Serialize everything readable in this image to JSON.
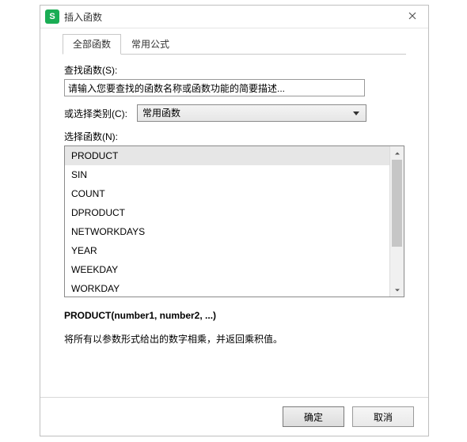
{
  "window": {
    "title": "插入函数",
    "close_label": "Close"
  },
  "tabs": [
    {
      "id": "all",
      "label": "全部函数",
      "active": true
    },
    {
      "id": "formula",
      "label": "常用公式",
      "active": false
    }
  ],
  "search": {
    "label": "查找函数(S):",
    "value": "请输入您要查找的函数名称或函数功能的简要描述..."
  },
  "category": {
    "label": "或选择类别(C):",
    "selected": "常用函数"
  },
  "list": {
    "label": "选择函数(N):",
    "items": [
      {
        "name": "PRODUCT",
        "selected": true
      },
      {
        "name": "SIN",
        "selected": false
      },
      {
        "name": "COUNT",
        "selected": false
      },
      {
        "name": "DPRODUCT",
        "selected": false
      },
      {
        "name": "NETWORKDAYS",
        "selected": false
      },
      {
        "name": "YEAR",
        "selected": false
      },
      {
        "name": "WEEKDAY",
        "selected": false
      },
      {
        "name": "WORKDAY",
        "selected": false
      }
    ]
  },
  "detail": {
    "signature": "PRODUCT(number1, number2, ...)",
    "description": "将所有以参数形式给出的数字相乘，并返回乘积值。"
  },
  "buttons": {
    "ok": "确定",
    "cancel": "取消"
  }
}
